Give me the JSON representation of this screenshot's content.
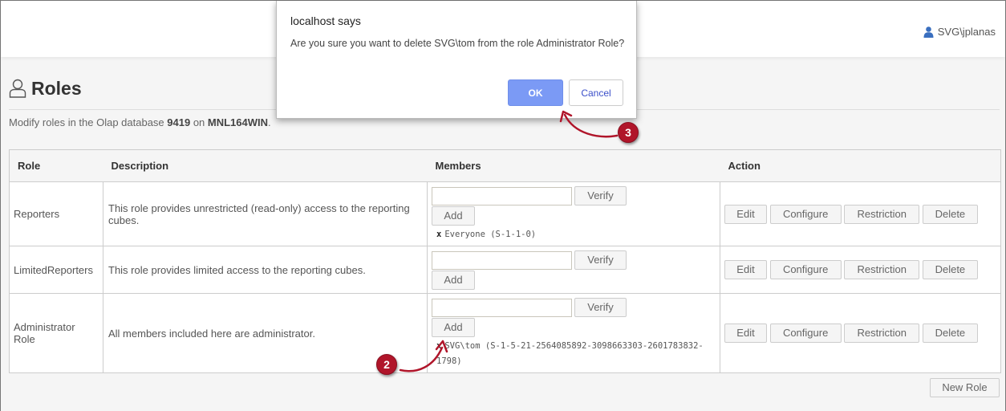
{
  "header": {
    "user_icon": "user-icon",
    "username": "SVG\\jplanas"
  },
  "page": {
    "title_icon": "person-outline-icon",
    "title": "Roles",
    "subtitle_prefix": "Modify roles in the Olap database ",
    "database": "9419",
    "subtitle_mid": " on ",
    "server": "MNL164WIN",
    "subtitle_suffix": "."
  },
  "table": {
    "headers": [
      "Role",
      "Description",
      "Members",
      "Action"
    ],
    "verify_label": "Verify",
    "add_label": "Add",
    "member_input_value": "",
    "remove_glyph": "x",
    "actions": [
      "Edit",
      "Configure",
      "Restriction",
      "Delete"
    ],
    "rows": [
      {
        "role": "Reporters",
        "description": "This role provides unrestricted (read-only) access to the reporting cubes.",
        "members": [
          "Everyone (S-1-1-0)"
        ]
      },
      {
        "role": "LimitedReporters",
        "description": "This role provides limited access to the reporting cubes.",
        "members": []
      },
      {
        "role": "Administrator Role",
        "description": "All members included here are administrator.",
        "members": [
          "SVG\\tom (S-1-5-21-2564085892-3098663303-2601783832-1798)"
        ]
      }
    ]
  },
  "new_role_label": "New Role",
  "dialog": {
    "title": "localhost says",
    "message": "Are you sure you want to delete SVG\\tom from the role Administrator Role?",
    "ok_label": "OK",
    "cancel_label": "Cancel",
    "ok_color": "#7b9af5"
  },
  "callouts": [
    {
      "label": "2",
      "color": "#b0152a"
    },
    {
      "label": "3",
      "color": "#b0152a"
    }
  ]
}
